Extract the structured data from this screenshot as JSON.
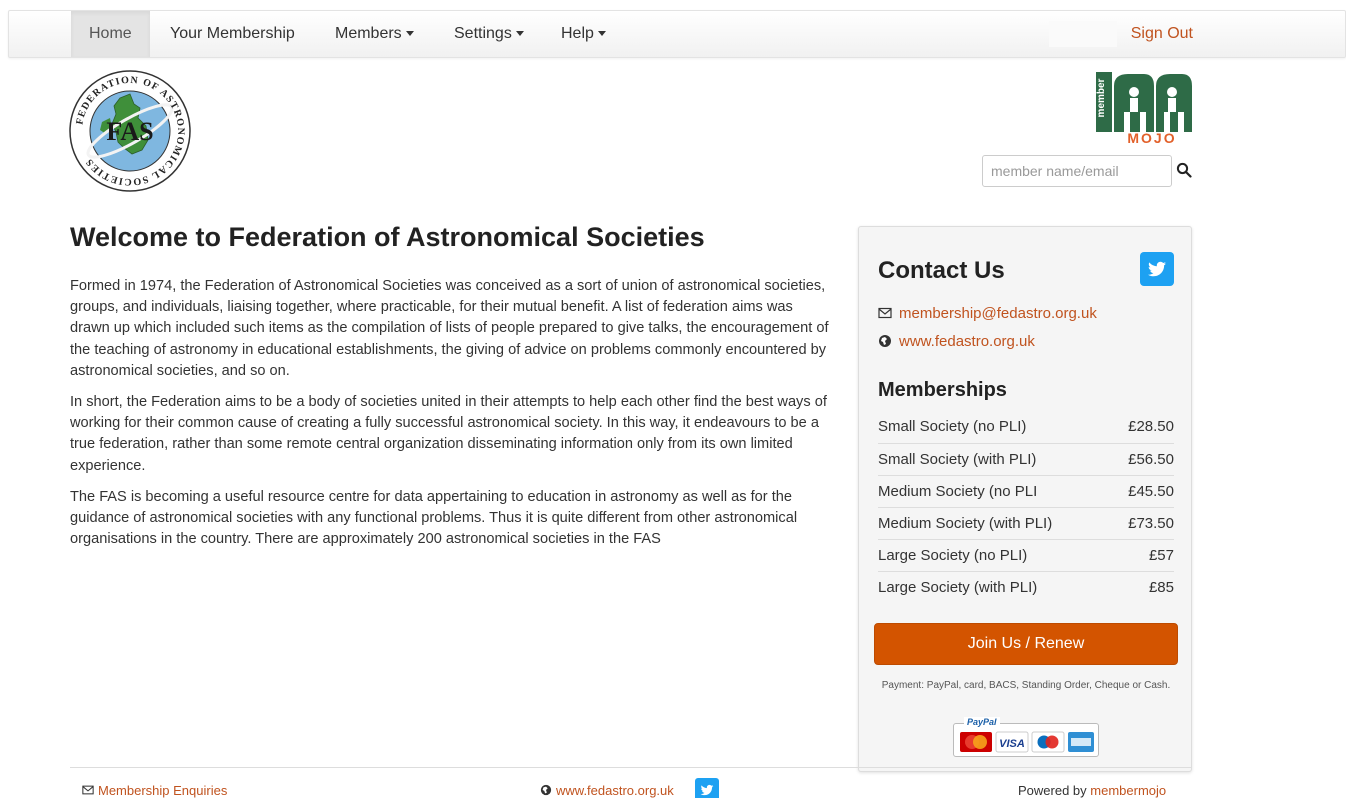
{
  "nav": {
    "items": [
      {
        "label": "Home",
        "active": true
      },
      {
        "label": "Your Membership",
        "active": false
      },
      {
        "label": "Members",
        "dropdown": true
      },
      {
        "label": "Settings",
        "dropdown": true
      },
      {
        "label": "Help",
        "dropdown": true
      }
    ],
    "sign_out": "Sign Out"
  },
  "logos": {
    "fas": {
      "text": "FAS",
      "ring_text": "FEDERATION OF ASTRONOMICAL SOCIETIES"
    },
    "membermojo": {
      "text_vertical": "member",
      "text_bottom": "MOJO"
    }
  },
  "search": {
    "placeholder": "member name/email",
    "icon": "search-icon"
  },
  "main": {
    "title": "Welcome to Federation of Astronomical Societies",
    "paragraphs": [
      "Formed in 1974, the Federation of Astronomical Societies was conceived as a sort of union of astronomical societies, groups, and individuals, liaising together, where practicable, for their mutual benefit. A list of federation aims was drawn up which included such items as the compilation of lists of people prepared to give talks, the encouragement of the teaching of astronomy in educational establishments, the giving of advice on problems commonly encountered by astronomical societies, and so on.",
      "In short, the Federation aims to be a body of societies united in their attempts to help each other find the best ways of working for their common cause of creating a fully successful astronomical society. In this way, it endeavours to be a true federation, rather than some remote central organization disseminating information only from its own limited experience.",
      "The FAS is becoming a useful resource centre for data appertaining to education in astronomy as well as for the guidance of astronomical societies with any functional problems. Thus it is quite different from other astronomical organisations in the country. There are approximately 200 astronomical societies in the FAS"
    ]
  },
  "contact": {
    "title": "Contact Us",
    "email": "membership@fedastro.org.uk",
    "website": "www.fedastro.org.uk",
    "memberships_title": "Memberships",
    "memberships": [
      {
        "name": "Small Society (no PLI)",
        "price": "£28.50"
      },
      {
        "name": "Small Society (with PLI)",
        "price": "£56.50"
      },
      {
        "name": "Medium Society (no PLI",
        "price": "£45.50"
      },
      {
        "name": "Medium Society (with PLI)",
        "price": "£73.50"
      },
      {
        "name": "Large Society (no PLI)",
        "price": "£57"
      },
      {
        "name": "Large Society (with PLI)",
        "price": "£85"
      }
    ],
    "join_button": "Join Us / Renew",
    "payment_note": "Payment: PayPal, card, BACS, Standing Order, Cheque or Cash.",
    "paypal_label": "PayPal",
    "cards": [
      "mastercard",
      "visa",
      "maestro",
      "amex"
    ],
    "visa_text": "VISA"
  },
  "footer": {
    "enquiries": "Membership Enquiries",
    "website": "www.fedastro.org.uk",
    "powered_prefix": "Powered by ",
    "powered_link": "membermojo"
  },
  "colors": {
    "accent": "#c0531f",
    "button": "#d35400",
    "twitter": "#1da1f2",
    "panel_bg": "#f5f5f5"
  }
}
